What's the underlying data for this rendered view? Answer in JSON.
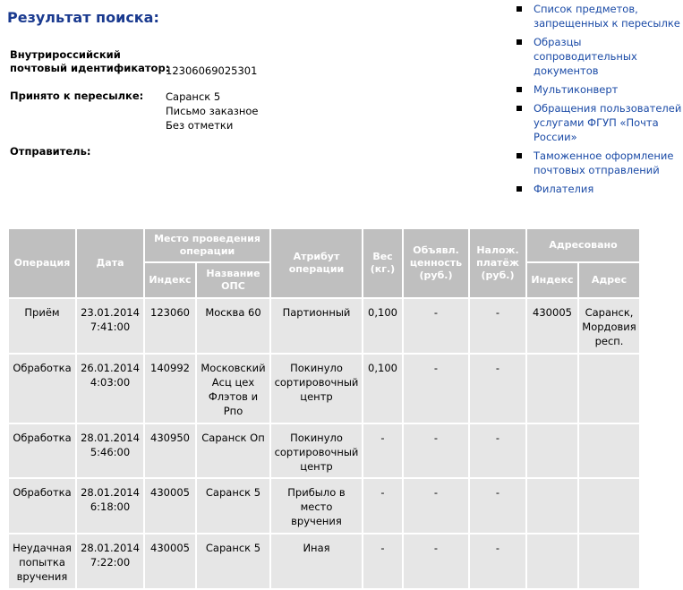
{
  "page": {
    "title": "Результат поиска:"
  },
  "info": {
    "id_label_line1": "Внутрироссийский",
    "id_label_line2": "почтовый идентификатор:",
    "id_value": "12306069025301",
    "accepted_label": "Принято к пересылке:",
    "accepted_lines": [
      "Саранск 5",
      "Письмо заказное",
      "Без отметки"
    ],
    "sender_label": "Отправитель:"
  },
  "sidebar": {
    "links": [
      {
        "line1": "Список предметов,",
        "line2": "запрещенных к пересылке",
        "line3": ""
      },
      {
        "line1": "Образцы",
        "line2": "сопроводительных",
        "line3": "документов"
      },
      {
        "line1": "Мультиконверт",
        "line2": "",
        "line3": ""
      },
      {
        "line1": "Обращения пользователей",
        "line2": "услугами ФГУП «Почта",
        "line3": "России»"
      },
      {
        "line1": "Таможенное оформление",
        "line2": "почтовых отправлений",
        "line3": ""
      },
      {
        "line1": "Филателия",
        "line2": "",
        "line3": ""
      }
    ]
  },
  "table": {
    "headers": {
      "operation": "Операция",
      "date": "Дата",
      "place_line1": "Место проведения",
      "place_line2": "операции",
      "index": "Индекс",
      "ops_name_line1": "Название",
      "ops_name_line2": "ОПС",
      "attribute_line1": "Атрибут",
      "attribute_line2": "операции",
      "weight_line1": "Вес",
      "weight_line2": "(кг.)",
      "declared_line1": "Объявл.",
      "declared_line2": "ценность",
      "declared_line3": "(руб.)",
      "cod_line1": "Налож.",
      "cod_line2": "платёж",
      "cod_line3": "(руб.)",
      "addressed": "Адресовано",
      "addr_index": "Индекс",
      "address": "Адрес"
    },
    "rows": [
      {
        "op1": "Приём",
        "op2": "",
        "op3": "",
        "date": "23.01.2014",
        "time": "7:41:00",
        "index": "123060",
        "name1": "Москва 60",
        "name2": "",
        "name3": "",
        "name4": "",
        "attr1": "Партионный",
        "attr2": "",
        "attr3": "",
        "weight": "0,100",
        "declared": "-",
        "cod": "-",
        "addr_index": "430005",
        "addr1": "Саранск,",
        "addr2": "Мордовия",
        "addr3": "респ."
      },
      {
        "op1": "Обработка",
        "op2": "",
        "op3": "",
        "date": "26.01.2014",
        "time": "4:03:00",
        "index": "140992",
        "name1": "Московский",
        "name2": "Асц цех",
        "name3": "Флэтов и",
        "name4": "Рпо",
        "attr1": "Покинуло",
        "attr2": "сортировочный",
        "attr3": "центр",
        "weight": "0,100",
        "declared": "-",
        "cod": "-",
        "addr_index": "",
        "addr1": "",
        "addr2": "",
        "addr3": ""
      },
      {
        "op1": "Обработка",
        "op2": "",
        "op3": "",
        "date": "28.01.2014",
        "time": "5:46:00",
        "index": "430950",
        "name1": "Саранск Оп",
        "name2": "",
        "name3": "",
        "name4": "",
        "attr1": "Покинуло",
        "attr2": "сортировочный",
        "attr3": "центр",
        "weight": "-",
        "declared": "-",
        "cod": "-",
        "addr_index": "",
        "addr1": "",
        "addr2": "",
        "addr3": ""
      },
      {
        "op1": "Обработка",
        "op2": "",
        "op3": "",
        "date": "28.01.2014",
        "time": "6:18:00",
        "index": "430005",
        "name1": "Саранск 5",
        "name2": "",
        "name3": "",
        "name4": "",
        "attr1": "Прибыло в",
        "attr2": "место",
        "attr3": "вручения",
        "weight": "-",
        "declared": "-",
        "cod": "-",
        "addr_index": "",
        "addr1": "",
        "addr2": "",
        "addr3": ""
      },
      {
        "op1": "Неудачная",
        "op2": "попытка",
        "op3": "вручения",
        "date": "28.01.2014",
        "time": "7:22:00",
        "index": "430005",
        "name1": "Саранск 5",
        "name2": "",
        "name3": "",
        "name4": "",
        "attr1": "Иная",
        "attr2": "",
        "attr3": "",
        "weight": "-",
        "declared": "-",
        "cod": "-",
        "addr_index": "",
        "addr1": "",
        "addr2": "",
        "addr3": ""
      }
    ]
  }
}
